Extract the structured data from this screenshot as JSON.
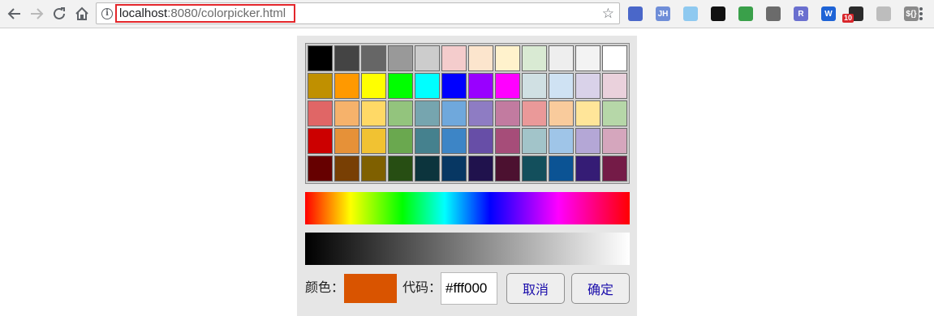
{
  "browser": {
    "url_host": "localhost",
    "url_rest": ":8080/colorpicker.html",
    "nav_icons": [
      "back-arrow-icon",
      "forward-arrow-icon",
      "reload-icon",
      "home-icon"
    ],
    "extensions": [
      {
        "name": "translate-extension-icon",
        "label": "",
        "color": "#4a67c9"
      },
      {
        "name": "jh-extension-icon",
        "label": "JH",
        "color": "#6f8ed8"
      },
      {
        "name": "ring-extension-icon",
        "label": "",
        "color": "#8ec9f0"
      },
      {
        "name": "eye-extension-icon",
        "label": "",
        "color": "#111111"
      },
      {
        "name": "shield-extension-icon",
        "label": "",
        "color": "#3aa04a"
      },
      {
        "name": "gear-extension-icon",
        "label": "",
        "color": "#6b6b6b"
      },
      {
        "name": "r-extension-icon",
        "label": "R",
        "color": "#6a6fcf"
      },
      {
        "name": "w-extension-icon",
        "label": "W",
        "color": "#1e63d6"
      },
      {
        "name": "counter-extension-icon",
        "label": "",
        "color": "#2b2b2b"
      },
      {
        "name": "pen-extension-icon",
        "label": "",
        "color": "#bdbdbd"
      },
      {
        "name": "jquery-extension-icon",
        "label": "${}",
        "color": "#8a8a8a"
      }
    ],
    "extension_badge": "10"
  },
  "picker": {
    "palette": [
      [
        "#000000",
        "#444444",
        "#666666",
        "#999999",
        "#cccccc",
        "#f4cccc",
        "#fce5cd",
        "#fff2cc",
        "#d9ead3",
        "#eeeeee",
        "#f3f3f3",
        "#ffffff"
      ],
      [
        "#c09000",
        "#ff9900",
        "#ffff00",
        "#00ff00",
        "#00ffff",
        "#0000ff",
        "#9900ff",
        "#ff00ff",
        "#d0e0e3",
        "#cfe2f3",
        "#d9d2e9",
        "#ead1dc"
      ],
      [
        "#e06666",
        "#f6b26b",
        "#ffd966",
        "#93c47d",
        "#76a5af",
        "#6fa8dc",
        "#8e7cc3",
        "#c27ba0",
        "#ea9999",
        "#f9cb9c",
        "#ffe599",
        "#b6d7a8"
      ],
      [
        "#cc0000",
        "#e69138",
        "#f1c232",
        "#6aa84f",
        "#45818e",
        "#3d85c6",
        "#674ea7",
        "#a64d79",
        "#a2c4c9",
        "#9fc5e8",
        "#b4a7d6",
        "#d5a6bd"
      ],
      [
        "#660000",
        "#783f04",
        "#7f6000",
        "#274e13",
        "#0c343d",
        "#073763",
        "#20124d",
        "#4c1130",
        "#134f5c",
        "#0b5394",
        "#351c75",
        "#741b47"
      ]
    ],
    "color_label": "颜色：",
    "preview_color": "#d95400",
    "code_label": "代码：",
    "code_value": "#fff000",
    "cancel_label": "取消",
    "confirm_label": "确定"
  }
}
